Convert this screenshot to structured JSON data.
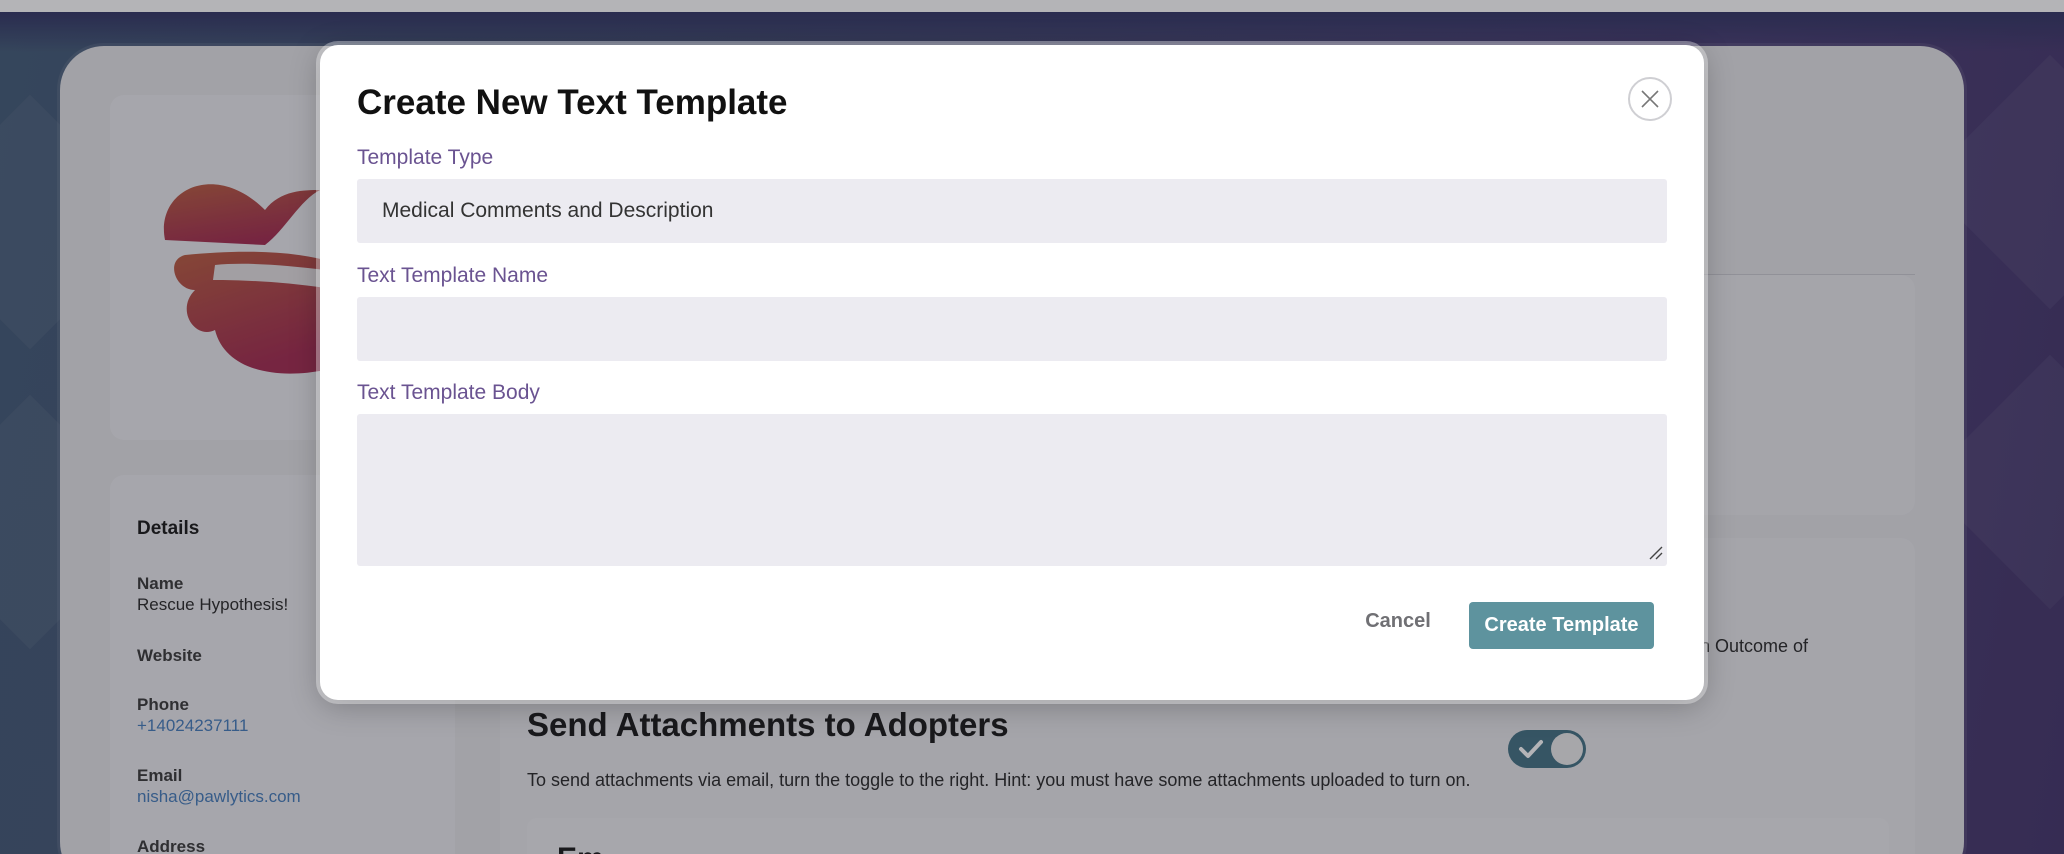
{
  "modal": {
    "title": "Create New Text Template",
    "close_icon": "close-icon",
    "template_type": {
      "label": "Template Type",
      "value": "Medical Comments and Description"
    },
    "template_name": {
      "label": "Text Template Name",
      "value": ""
    },
    "template_body": {
      "label": "Text Template Body",
      "value": ""
    },
    "cancel_label": "Cancel",
    "create_label": "Create Template"
  },
  "background": {
    "details": {
      "heading": "Details",
      "name_label": "Name",
      "name_value": "Rescue Hypothesis!",
      "website_label": "Website",
      "phone_label": "Phone",
      "phone_value": "+14024237111",
      "email_label": "Email",
      "email_value": "nisha@pawlytics.com",
      "address_label": "Address"
    },
    "partial_text": "n Outcome of",
    "attachments": {
      "title": "Send Attachments to Adopters",
      "description": "To send attachments via email, turn the toggle to the right. Hint: you must have some attachments uploaded to turn on.",
      "toggle_on": true
    },
    "inner_card_title": "Em"
  },
  "colors": {
    "accent": "#5e939e",
    "label": "#6a5391",
    "toggle": "#3e6e80",
    "link": "#3f78b9"
  }
}
